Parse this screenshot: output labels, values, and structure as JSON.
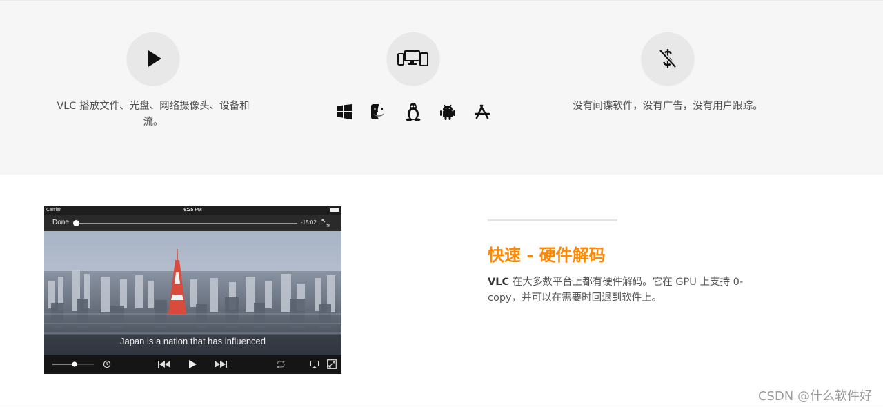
{
  "features": {
    "playback": {
      "icon": "play-icon",
      "text": "VLC 播放文件、光盘、网络摄像头、设备和流。"
    },
    "platforms": {
      "icon": "devices-icon",
      "items": [
        "windows-icon",
        "finder-icon",
        "linux-icon",
        "android-icon",
        "app-store-icon"
      ]
    },
    "free": {
      "icon": "no-dollar-icon",
      "text": "没有间谍软件，没有广告，没有用户跟踪。"
    }
  },
  "player": {
    "carrier": "Carrier",
    "clock": "6:25 PM",
    "done_label": "Done",
    "remaining_time": "-15:02",
    "subtitle": "Japan is a nation that has influenced",
    "controls": [
      "volume-slider",
      "clock-icon",
      "rewind-icon",
      "play-icon",
      "fast-forward-icon",
      "repeat-icon",
      "airplay-icon",
      "aspect-ratio-icon"
    ]
  },
  "hw_decoding": {
    "title": "快速 - 硬件解码",
    "desc_strong": "VLC",
    "desc_rest": " 在大多数平台上都有硬件解码。它在 GPU 上支持 0-copy，并可以在需要时回退到软件上。"
  },
  "watermark": "CSDN @什么软件好",
  "colors": {
    "accent": "#ff8800",
    "band_bg": "#f6f6f6",
    "icon_circle": "#e8e8e8"
  }
}
